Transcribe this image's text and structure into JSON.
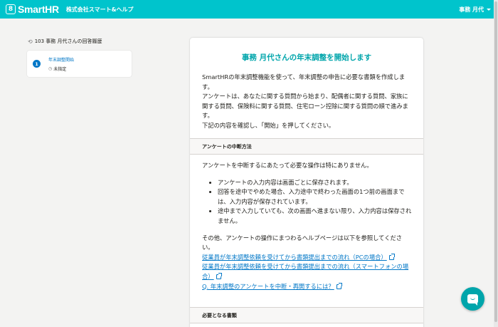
{
  "header": {
    "logo_mark": "8",
    "logo_text": "SmartHR",
    "company": "株式会社スマート&ヘルプ",
    "user_name": "事務 月代",
    "colors": {
      "brand": "#00c4cc"
    }
  },
  "sidebar": {
    "history_icon": "history-icon",
    "history_title": "103 事務 月代さんの回答履歴",
    "items": [
      {
        "number": "1",
        "label": "年末調整開始",
        "status": "未指定",
        "status_icon": "clock-icon"
      }
    ]
  },
  "main": {
    "title": "事務 月代さんの年末調整を開始します",
    "intro": [
      "SmartHRの年末調整機能を使って、年末調整の申告に必要な書類を作成します。",
      "アンケートは、あなたに関する質問から始まり、配偶者に関する質問、家族に関する質問、保険料に関する質問、住宅ローン控除に関する質問の順で進みます。",
      "下記の内容を確認し、「開始」を押してください。"
    ],
    "sections": [
      {
        "heading": "アンケートの中断方法",
        "lead": "アンケートを中断するにあたって必要な操作は特にありません。",
        "bullets": [
          "アンケートの入力内容は画面ごとに保存されます。",
          "回答を途中でやめた場合、入力途中で終わった画面の1つ前の画面までは、入力内容が保存されています。",
          "途中まで入力していても、次の画面へ進まない限り、入力内容は保存されません。"
        ],
        "after": "その他、アンケートの操作にまつわるヘルプページは以下を参照してください。",
        "links": [
          "従業員が年末調整依頼を受けてから書類提出までの流れ（PCの場合）",
          "従業員が年末調整依頼を受けてから書類提出までの流れ（スマートフォンの場合）",
          "Q. 年末調整のアンケートを中断・再開するには？"
        ]
      },
      {
        "heading": "必要となる書類"
      }
    ]
  },
  "chat": {
    "icon": "chat-icon"
  }
}
